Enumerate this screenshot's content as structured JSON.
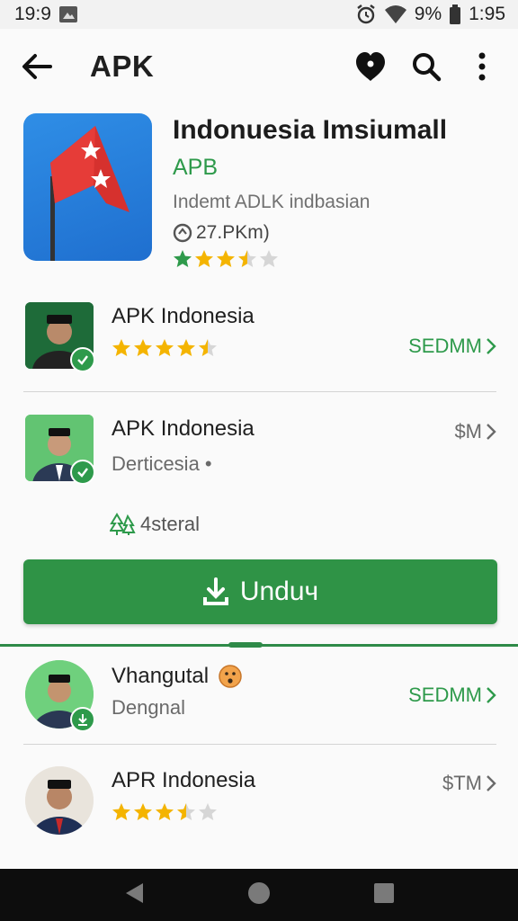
{
  "status_bar": {
    "time_left": "19:9",
    "battery_pct": "9%",
    "time_right": "1:95"
  },
  "app_bar": {
    "title": "APK"
  },
  "hero": {
    "name": "Indonuesia Imsiumall",
    "developer": "APB",
    "category": "Indemt ADLK indbasian",
    "downloads": "27.PKm)",
    "rating_stars": 3.5
  },
  "list": [
    {
      "title": "APK Indonesia",
      "rating_stars": 4.5,
      "action": "SEDMM",
      "action_color": "#2e9a4b"
    },
    {
      "title": "APK Indonesia",
      "subtitle": "Derticesia •",
      "tag": "4steral",
      "action": "$M",
      "action_color": "#6a6a6a"
    }
  ],
  "install_button": {
    "label": "Unduч"
  },
  "sheet": [
    {
      "title": "Vhangutal",
      "subtitle": "Dengnal",
      "action": "SEDMM",
      "action_color": "#2e9a4b"
    },
    {
      "title": "APR Indonesia",
      "rating_stars": 3.5,
      "action": "$TM",
      "action_color": "#6a6a6a"
    }
  ],
  "colors": {
    "accent_green": "#2e9a4b",
    "star_gold": "#f4b400"
  },
  "icons": [
    "back-arrow-icon",
    "heart-icon",
    "search-icon",
    "more-vert-icon",
    "download-icon",
    "chevron-right-icon"
  ]
}
